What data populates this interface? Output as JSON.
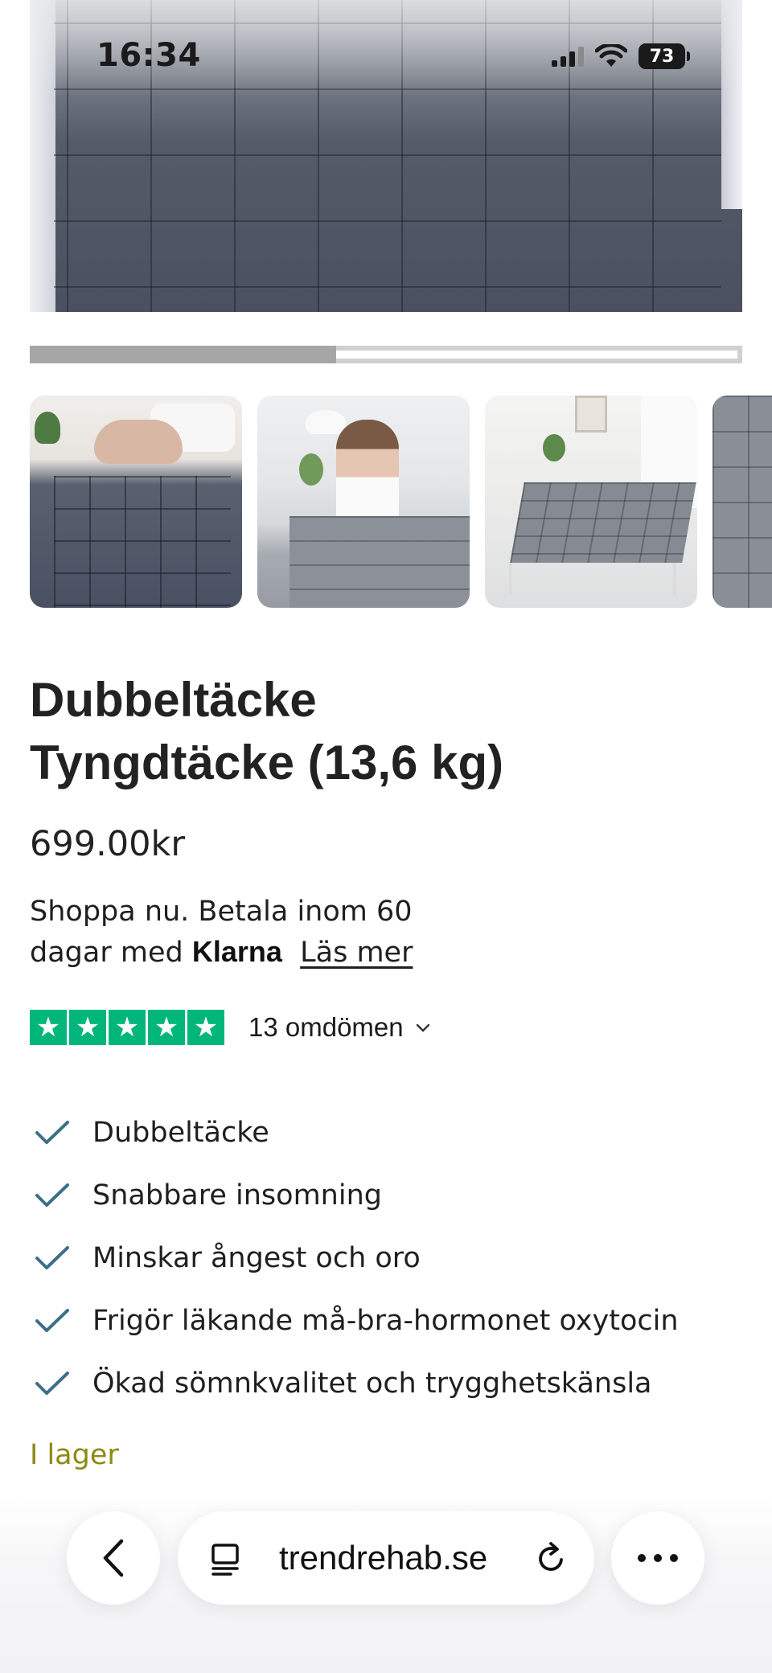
{
  "status_bar": {
    "time": "16:34",
    "battery": "73"
  },
  "gallery": {
    "progress_fraction": 0.43,
    "thumbnails": [
      {
        "name": "thumbnail-woman-sleeping"
      },
      {
        "name": "thumbnail-woman-sitting"
      },
      {
        "name": "thumbnail-bed-room"
      },
      {
        "name": "thumbnail-blanket-closeup"
      }
    ]
  },
  "product": {
    "title_line1": "Dubbeltäcke",
    "title_line2": "Tyngdtäcke (13,6 kg)",
    "price": "699.00kr",
    "klarna_line1": "Shoppa nu. Betala inom 60",
    "klarna_line2_prefix": "dagar med",
    "klarna_brand": "Klarna",
    "klarna_link": "Läs mer",
    "rating_stars": 5,
    "review_count": "13 omdömen",
    "features": [
      "Dubbeltäcke",
      "Snabbare insomning",
      "Minskar ångest och oro",
      "Frigör läkande må-bra-hormonet oxytocin",
      "Ökad sömnkvalitet och trygghetskänsla"
    ],
    "stock": "I lager"
  },
  "browser": {
    "url": "trendrehab.se"
  },
  "colors": {
    "trustpilot_green": "#00b67a",
    "check_blue": "#3d6f89",
    "stock_olive": "#8e8a16"
  }
}
